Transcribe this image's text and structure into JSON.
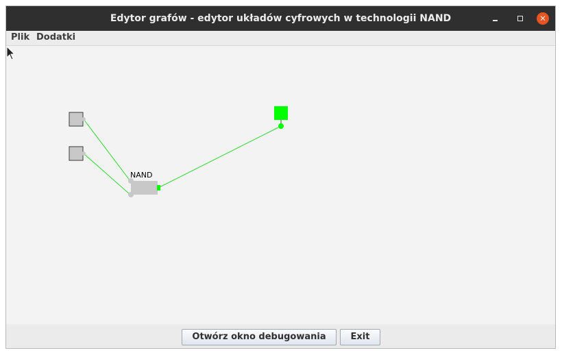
{
  "window": {
    "title": "Edytor grafów - edytor układów cyfrowych w technologii NAND",
    "controls": {
      "close_glyph": "✕"
    }
  },
  "menu": {
    "items": [
      "Plik",
      "Dodatki"
    ]
  },
  "canvas": {
    "gate_label": "NAND",
    "wire_color": "#32d632",
    "active_color": "#00ff00",
    "inactive_color": "#c8c8c8",
    "node_border": "#3a3a3a"
  },
  "buttons": {
    "debug_label": "Otwórz okno debugowania",
    "exit_label": "Exit"
  }
}
